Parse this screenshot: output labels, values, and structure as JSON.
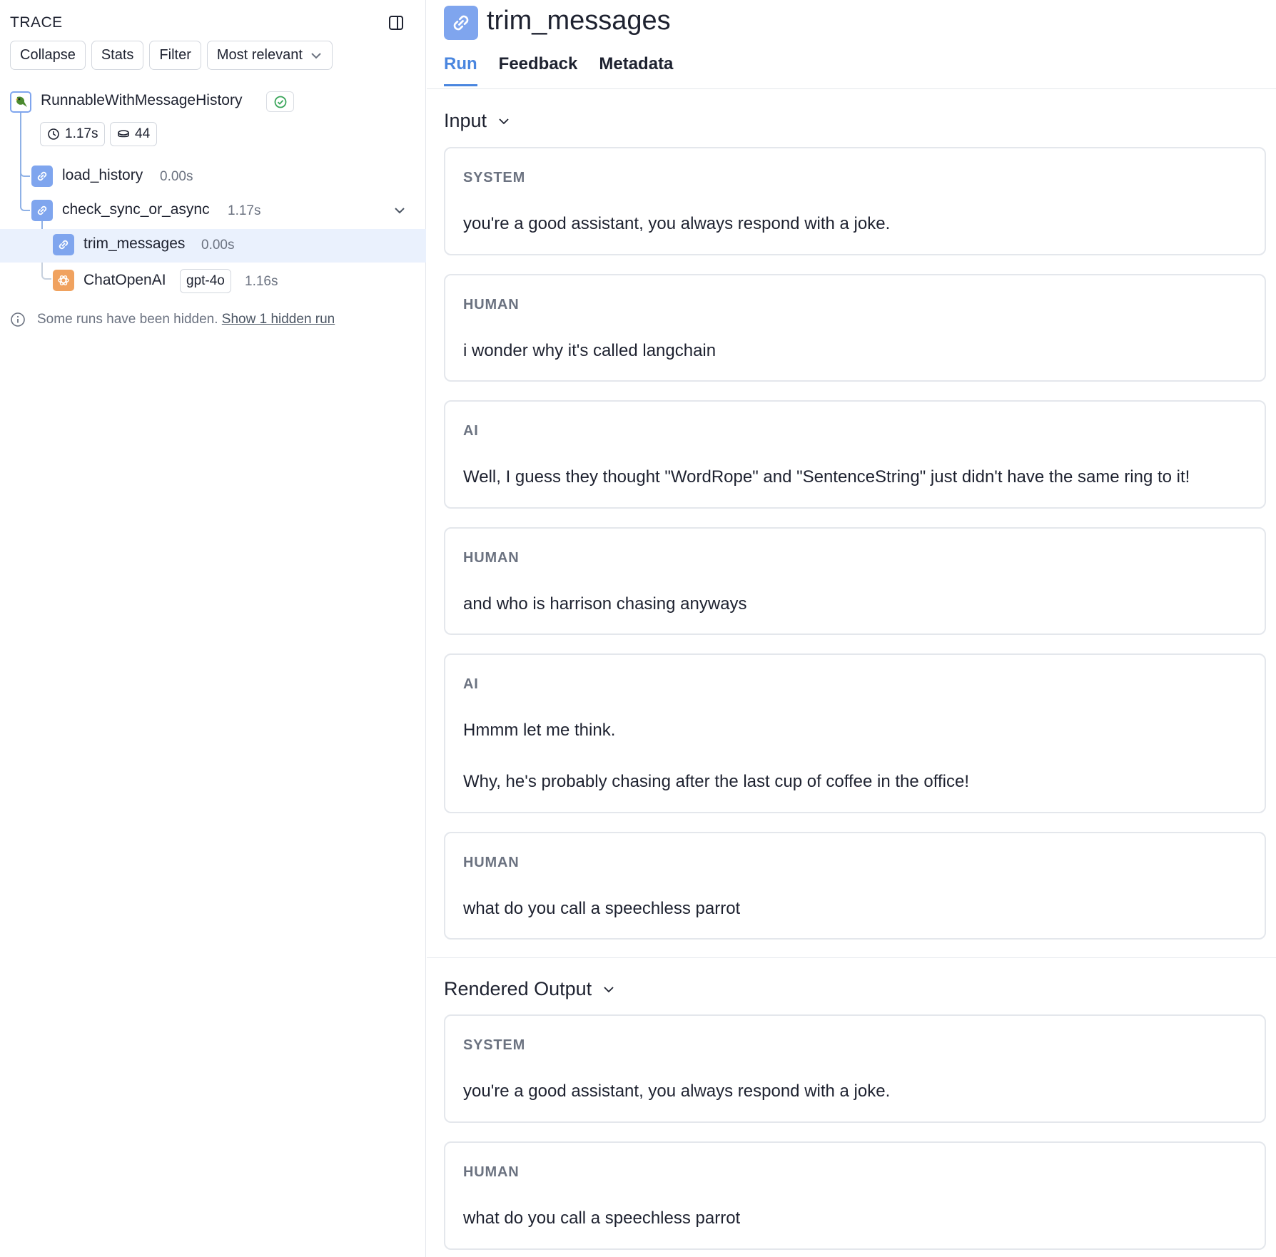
{
  "trace": {
    "title": "TRACE",
    "toolbar": {
      "collapse": "Collapse",
      "stats": "Stats",
      "filter": "Filter",
      "sort": "Most relevant"
    },
    "root": {
      "label": "RunnableWithMessageHistory",
      "latency": "1.17s",
      "tokens": "44",
      "status": "success"
    },
    "nodes": [
      {
        "label": "load_history",
        "time": "0.00s"
      },
      {
        "label": "check_sync_or_async",
        "time": "1.17s"
      },
      {
        "label": "trim_messages",
        "time": "0.00s"
      },
      {
        "label": "ChatOpenAI",
        "model": "gpt-4o",
        "time": "1.16s"
      }
    ],
    "hidden_note": "Some runs have been hidden.",
    "hidden_link": "Show 1 hidden run"
  },
  "run": {
    "title": "trim_messages",
    "tabs": [
      "Run",
      "Feedback",
      "Metadata"
    ],
    "active_tab": "Run"
  },
  "input": {
    "heading": "Input",
    "messages": [
      {
        "role": "SYSTEM",
        "text": "you're a good assistant, you always respond with a joke."
      },
      {
        "role": "HUMAN",
        "text": "i wonder why it's called langchain"
      },
      {
        "role": "AI",
        "text": "Well, I guess they thought \"WordRope\" and \"SentenceString\" just didn't have the same ring to it!"
      },
      {
        "role": "HUMAN",
        "text": "and who is harrison chasing anyways"
      },
      {
        "role": "AI",
        "text": "Hmmm let me think.",
        "text2": "Why, he's probably chasing after the last cup of coffee in the office!"
      },
      {
        "role": "HUMAN",
        "text": "what do you call a speechless parrot"
      }
    ]
  },
  "output": {
    "heading": "Rendered Output",
    "messages": [
      {
        "role": "SYSTEM",
        "text": "you're a good assistant, you always respond with a joke."
      },
      {
        "role": "HUMAN",
        "text": "what do you call a speechless parrot"
      }
    ]
  },
  "colors": {
    "accent": "#4a86df",
    "chain_icon": "#7fa5ee",
    "openai_icon": "#f0a25f",
    "selected_row": "#eaf1fd",
    "success": "#3aa55a"
  },
  "icons": {
    "panel_toggle": "sidebar-toggle-icon",
    "chain": "link-icon",
    "openai": "openai-icon",
    "root": "parrot-icon",
    "latency": "clock-icon",
    "tokens": "coins-icon",
    "info": "info-icon",
    "chevron": "chevron-down-icon"
  }
}
